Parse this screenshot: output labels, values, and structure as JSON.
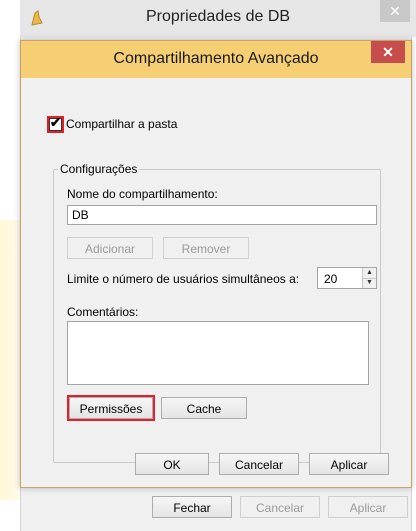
{
  "outer": {
    "title": "Propriedades de DB",
    "close": "✕",
    "buttons": {
      "close": "Fechar",
      "cancel": "Cancelar",
      "apply": "Aplicar"
    }
  },
  "dialog": {
    "title": "Compartilhamento Avançado",
    "close": "✕",
    "share_checkbox_label": "Compartilhar a pasta",
    "share_checked": true,
    "group_label": "Configurações",
    "share_name_label": "Nome do compartilhamento:",
    "share_name_value": "DB",
    "add_button": "Adicionar",
    "remove_button": "Remover",
    "limit_label": "Limite o número de usuários simultâneos a:",
    "limit_value": "20",
    "comments_label": "Comentários:",
    "comments_value": "",
    "permissions_button": "Permissões",
    "cache_button": "Cache",
    "ok_button": "OK",
    "cancel_button": "Cancelar",
    "apply_button": "Aplicar"
  },
  "colors": {
    "dialog_titlebar": "#f6cf74",
    "dialog_close": "#c74d4d",
    "highlight": "#e0202a"
  },
  "icons": {
    "folder": "folder-icon",
    "check": "✔",
    "spin_up": "▲",
    "spin_down": "▼"
  }
}
